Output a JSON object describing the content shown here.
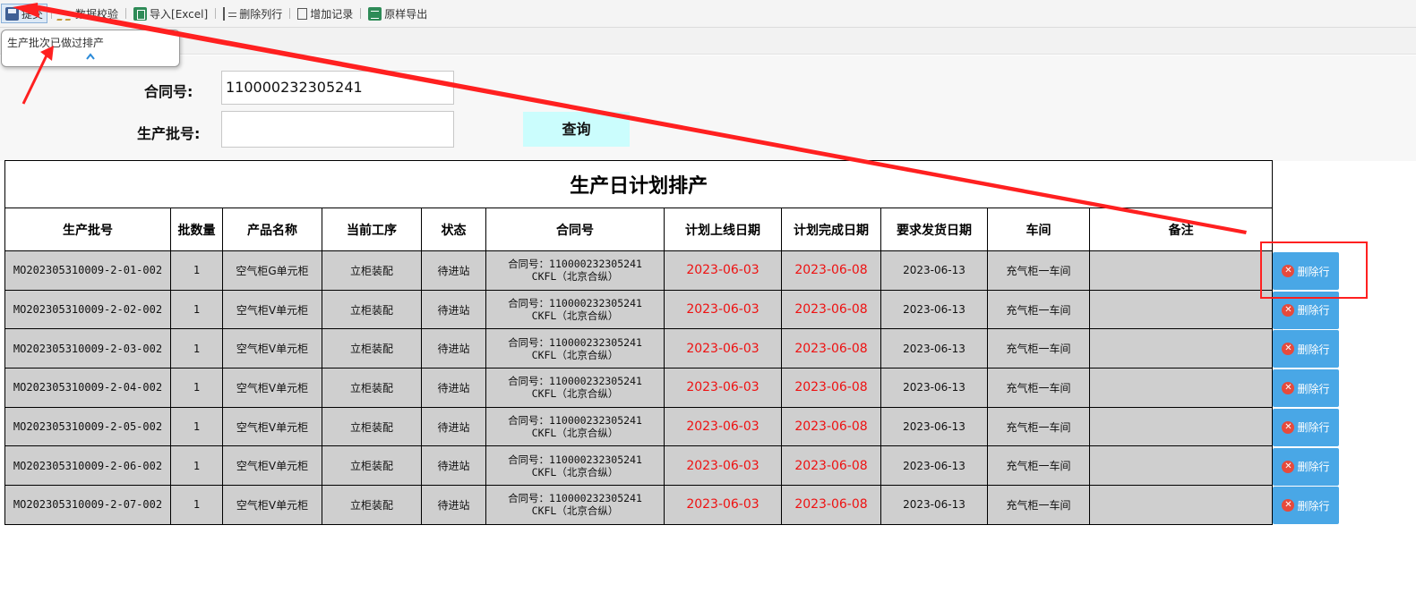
{
  "toolbar": {
    "submit": "提交",
    "validate": "数据校验",
    "import_excel": "导入[Excel]",
    "delete_col": "删除列行",
    "add_record": "增加记录",
    "export": "原样导出"
  },
  "tooltip": {
    "text": "生产批次已做过排产"
  },
  "form": {
    "contract_label": "合同号:",
    "contract_value": "110000232305241",
    "batch_label": "生产批号:",
    "batch_value": "",
    "query_button": "查询"
  },
  "table": {
    "title": "生产日计划排产",
    "headers": [
      "生产批号",
      "批数量",
      "产品名称",
      "当前工序",
      "状态",
      "合同号",
      "计划上线日期",
      "计划完成日期",
      "要求发货日期",
      "车间",
      "备注"
    ],
    "rows": [
      {
        "batch": "MO202305310009-2-01-002",
        "qty": "1",
        "product": "空气柜G单元柜",
        "process": "立柜装配",
        "status": "待进站",
        "contract_line1": "合同号：110000232305241",
        "contract_line2": "CKFL（北京合纵）",
        "plan_start": "2023-06-03",
        "plan_end": "2023-06-08",
        "ship_date": "2023-06-13",
        "workshop": "充气柜一车间",
        "remark": ""
      },
      {
        "batch": "MO202305310009-2-02-002",
        "qty": "1",
        "product": "空气柜V单元柜",
        "process": "立柜装配",
        "status": "待进站",
        "contract_line1": "合同号：110000232305241",
        "contract_line2": "CKFL（北京合纵）",
        "plan_start": "2023-06-03",
        "plan_end": "2023-06-08",
        "ship_date": "2023-06-13",
        "workshop": "充气柜一车间",
        "remark": ""
      },
      {
        "batch": "MO202305310009-2-03-002",
        "qty": "1",
        "product": "空气柜V单元柜",
        "process": "立柜装配",
        "status": "待进站",
        "contract_line1": "合同号：110000232305241",
        "contract_line2": "CKFL（北京合纵）",
        "plan_start": "2023-06-03",
        "plan_end": "2023-06-08",
        "ship_date": "2023-06-13",
        "workshop": "充气柜一车间",
        "remark": ""
      },
      {
        "batch": "MO202305310009-2-04-002",
        "qty": "1",
        "product": "空气柜V单元柜",
        "process": "立柜装配",
        "status": "待进站",
        "contract_line1": "合同号：110000232305241",
        "contract_line2": "CKFL（北京合纵）",
        "plan_start": "2023-06-03",
        "plan_end": "2023-06-08",
        "ship_date": "2023-06-13",
        "workshop": "充气柜一车间",
        "remark": ""
      },
      {
        "batch": "MO202305310009-2-05-002",
        "qty": "1",
        "product": "空气柜V单元柜",
        "process": "立柜装配",
        "status": "待进站",
        "contract_line1": "合同号：110000232305241",
        "contract_line2": "CKFL（北京合纵）",
        "plan_start": "2023-06-03",
        "plan_end": "2023-06-08",
        "ship_date": "2023-06-13",
        "workshop": "充气柜一车间",
        "remark": ""
      },
      {
        "batch": "MO202305310009-2-06-002",
        "qty": "1",
        "product": "空气柜V单元柜",
        "process": "立柜装配",
        "status": "待进站",
        "contract_line1": "合同号：110000232305241",
        "contract_line2": "CKFL（北京合纵）",
        "plan_start": "2023-06-03",
        "plan_end": "2023-06-08",
        "ship_date": "2023-06-13",
        "workshop": "充气柜一车间",
        "remark": ""
      },
      {
        "batch": "MO202305310009-2-07-002",
        "qty": "1",
        "product": "空气柜V单元柜",
        "process": "立柜装配",
        "status": "待进站",
        "contract_line1": "合同号：110000232305241",
        "contract_line2": "CKFL（北京合纵）",
        "plan_start": "2023-06-03",
        "plan_end": "2023-06-08",
        "ship_date": "2023-06-13",
        "workshop": "充气柜一车间",
        "remark": ""
      }
    ],
    "delete_label": "删除行"
  },
  "colors": {
    "date_red": "#ee1111",
    "delete_blue": "#49a7e6",
    "annotation_red": "#ff2020",
    "query_bg": "#cbfdfd",
    "row_gray": "#cfcfcf"
  }
}
